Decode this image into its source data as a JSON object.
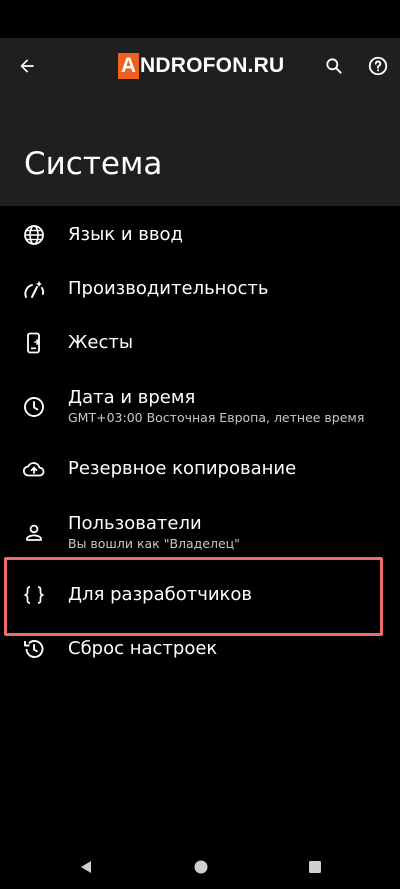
{
  "header": {
    "logo_letter": "A",
    "logo_rest": "NDROFON.RU",
    "title": "Система"
  },
  "items": [
    {
      "title": "Язык и ввод",
      "icon": "globe-icon"
    },
    {
      "title": "Производительность",
      "icon": "performance-icon"
    },
    {
      "title": "Жесты",
      "icon": "gestures-icon"
    },
    {
      "title": "Дата и время",
      "subtitle": "GMT+03:00 Восточная Европа, летнее время",
      "icon": "clock-icon"
    },
    {
      "title": "Резервное копирование",
      "icon": "cloud-upload-icon"
    },
    {
      "title": "Пользователи",
      "subtitle": "Вы вошли как \"Владелец\"",
      "icon": "person-icon"
    },
    {
      "title": "Для разработчиков",
      "icon": "braces-icon"
    },
    {
      "title": "Сброс настроек",
      "icon": "history-icon"
    }
  ],
  "colors": {
    "accent_highlight": "#ee6b6e",
    "logo_orange": "#f0601e",
    "header_bg": "#1f1f1f"
  }
}
